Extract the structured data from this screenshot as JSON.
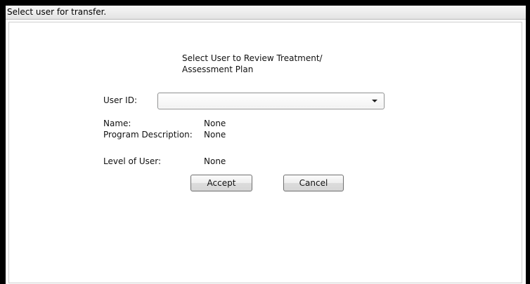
{
  "window": {
    "title": "Select user for transfer."
  },
  "dialog": {
    "heading_line1": "Select User to Review Treatment/",
    "heading_line2": "Assessment Plan",
    "user_id_label": "User ID:",
    "user_id_value": "",
    "name_label": "Name:",
    "name_value": "None",
    "program_label": "Program Description:",
    "program_value": "None",
    "level_label": "Level of User:",
    "level_value": "None",
    "accept_label": "Accept",
    "cancel_label": "Cancel"
  },
  "icons": {
    "dropdown": "chevron-down-icon"
  },
  "colors": {
    "frame": "#000000",
    "background": "#ffffff",
    "titlebar": "#ececec"
  }
}
